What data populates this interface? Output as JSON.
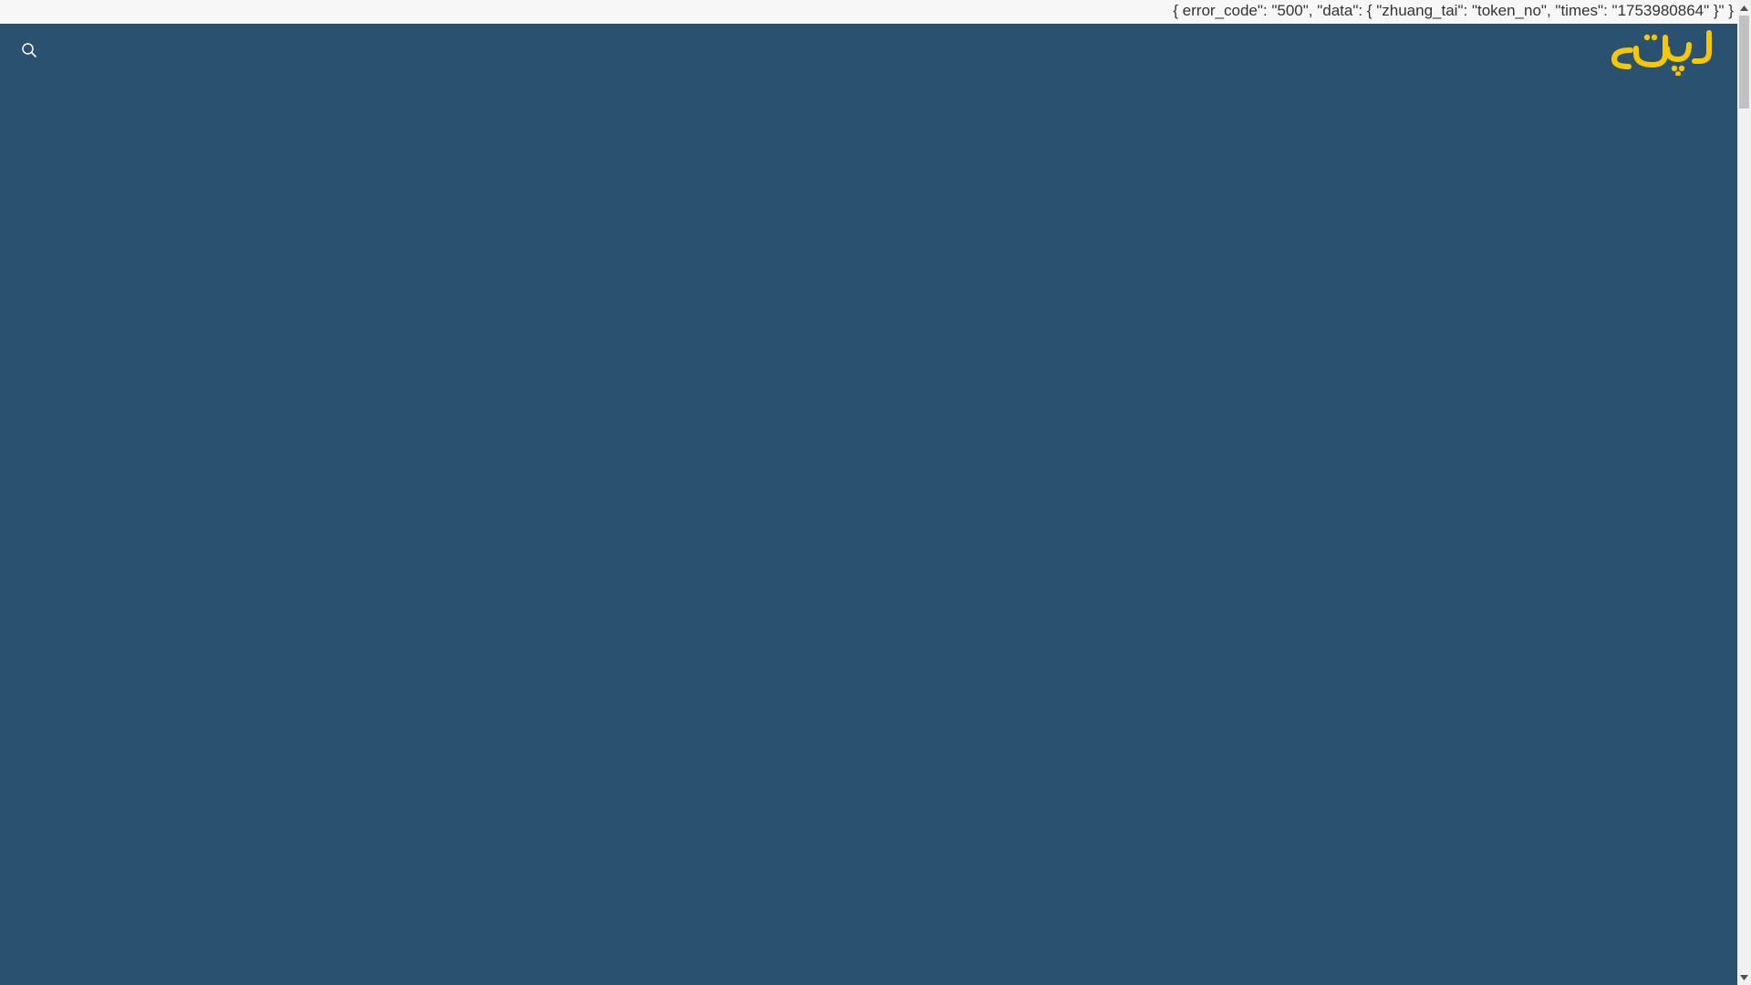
{
  "error_banner": {
    "text": "{ error_code\": \"500\", \"data\": { \"zhuang_tai\": \"token_no\", \"times\": \"1753980864\" }\" }"
  },
  "header": {
    "search_icon": "search-icon",
    "logo_text": "لپتل",
    "logo_color": "#f5c800"
  },
  "theme": {
    "background": "#2b5170",
    "banner_background": "#f7f7f7"
  },
  "scrollbar": {
    "up_icon": "triangle-up-icon",
    "down_icon": "triangle-down-icon"
  }
}
